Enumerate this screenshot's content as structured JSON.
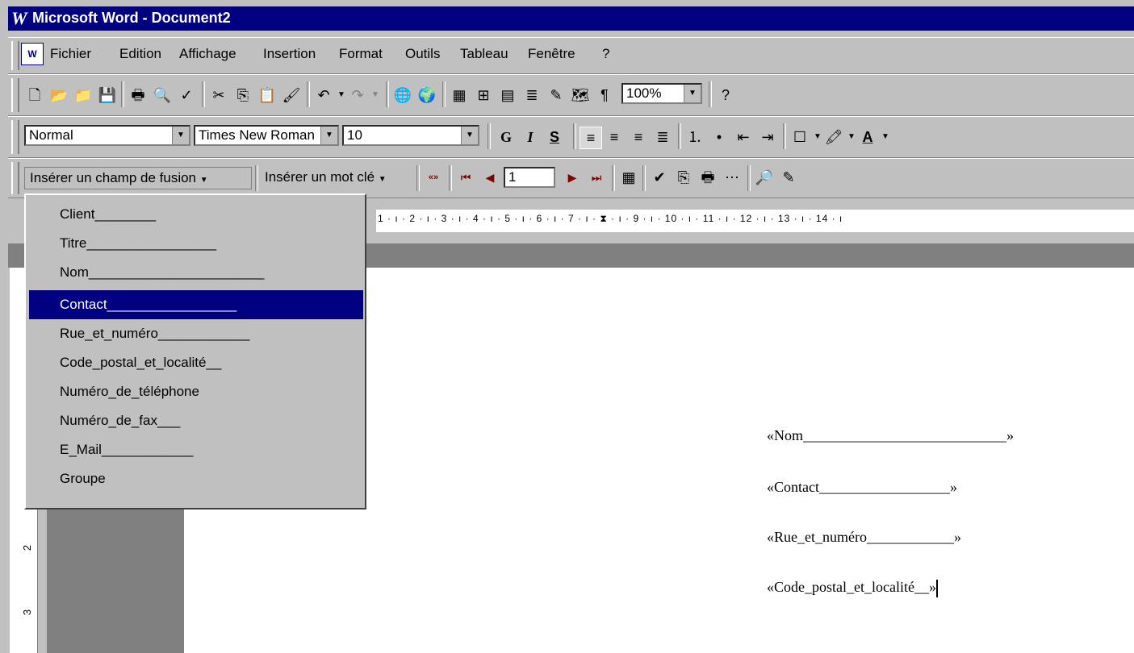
{
  "app": {
    "title": "Microsoft Word - Document2",
    "logo_letter": "W"
  },
  "menubar": {
    "items": [
      {
        "label": "Fichier"
      },
      {
        "label": "Edition"
      },
      {
        "label": "Affichage"
      },
      {
        "label": "Insertion"
      },
      {
        "label": "Format"
      },
      {
        "label": "Outils"
      },
      {
        "label": "Tableau"
      },
      {
        "label": "Fenêtre"
      },
      {
        "label": "?"
      }
    ]
  },
  "standard_toolbar": {
    "zoom": "100%"
  },
  "formatting_toolbar": {
    "style": "Normal",
    "font": "Times New Roman",
    "size": "10",
    "bold_label": "G",
    "italic_label": "I",
    "underline_label": "S"
  },
  "mailmerge_toolbar": {
    "insert_field_label": "Insérer un champ de fusion",
    "insert_keyword_label": "Insérer un mot clé",
    "record_number": "1"
  },
  "ruler": {
    "ticks": "1 · ı · 2 · ı · 3 · ı · 4 · ı · 5 · ı · 6 · ı · 7 · ı · ⧗ · ı · 9 · ı · 10 · ı · 11 · ı · 12 · ı · 13 · ı · 14 · ı",
    "vertical_marks": [
      "2",
      "3"
    ]
  },
  "dropdown": {
    "items": [
      "Client________",
      "Titre_________________",
      "Nom_______________________",
      "Contact_________________",
      "Rue_et_numéro____________",
      "Code_postal_et_localité__",
      "Numéro_de_téléphone",
      "Numéro_de_fax___",
      "E_Mail____________",
      "Groupe"
    ],
    "selected_index": 3
  },
  "document": {
    "fields": [
      "«Nom____________________________»",
      "«Contact__________________»",
      "«Rue_et_numéro____________»",
      "«Code_postal_et_localité__»"
    ]
  }
}
